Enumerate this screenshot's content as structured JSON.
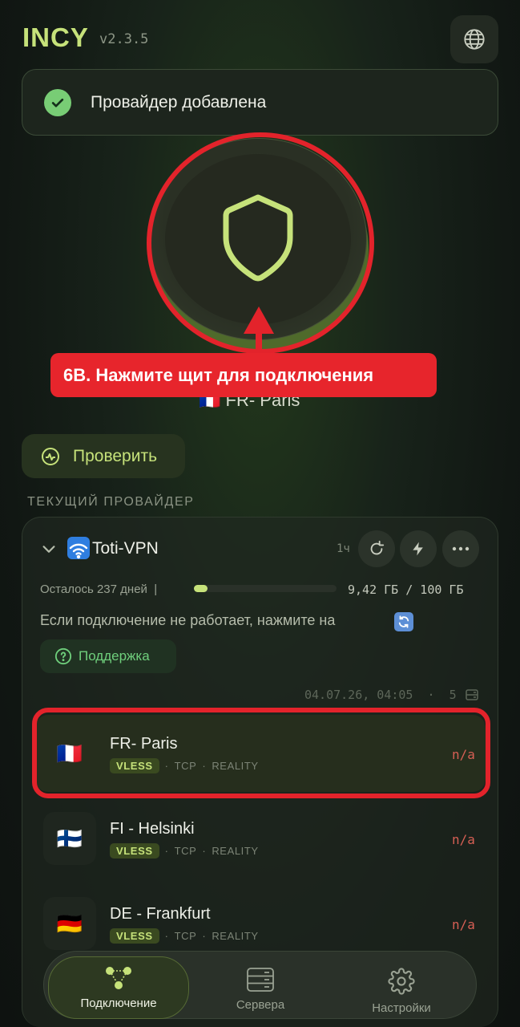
{
  "header": {
    "logo": "INCY",
    "version": "v2.3.5"
  },
  "toast": {
    "message": "Провайдер добавлена"
  },
  "annotation": {
    "text": "6В. Нажмите щит для подключения"
  },
  "selected_server": {
    "flag": "🇫🇷",
    "name": "FR- Paris"
  },
  "check_button": {
    "label": "Проверить"
  },
  "section": {
    "current_provider": "ТЕКУЩИЙ ПРОВАЙДЕР"
  },
  "provider": {
    "name": "Toti-VPN",
    "age": "1ч",
    "days_left": "Осталось 237 дней",
    "separator": "|",
    "usage": "9,42 ГБ / 100 ГБ",
    "usage_fraction": 0.0942,
    "hint": "Если подключение не работает, нажмите на",
    "support_label": "Поддержка",
    "updated": "04.07.26, 04:05",
    "dot": "·",
    "server_count": "5"
  },
  "servers": [
    {
      "flag": "🇫🇷",
      "name": "FR- Paris",
      "protocol": "VLESS",
      "transport": "TCP",
      "security": "REALITY",
      "ping": "n/a"
    },
    {
      "flag": "🇫🇮",
      "name": "FI - Helsinki",
      "protocol": "VLESS",
      "transport": "TCP",
      "security": "REALITY",
      "ping": "n/a"
    },
    {
      "flag": "🇩🇪",
      "name": "DE - Frankfurt",
      "protocol": "VLESS",
      "transport": "TCP",
      "security": "REALITY",
      "ping": "n/a"
    }
  ],
  "tag_separator": "·",
  "nav": {
    "connection": "Подключение",
    "servers": "Сервера",
    "settings": "Настройки"
  },
  "colors": {
    "accent": "#c6e27a",
    "highlight_red": "#e3232b",
    "success": "#78cd75",
    "ping_na": "#d65f54"
  }
}
